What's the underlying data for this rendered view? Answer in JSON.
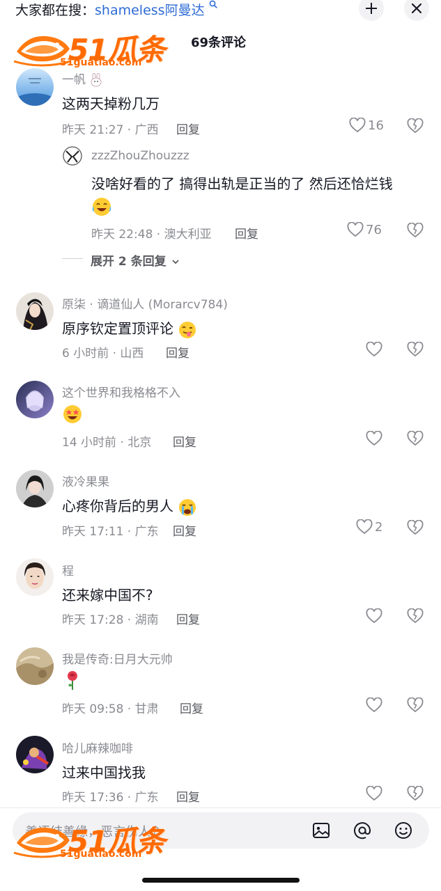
{
  "search": {
    "prefix": "大家都在搜：",
    "keyword": "shameless阿曼达",
    "search_glyph": "search-icon"
  },
  "logo": {
    "number": "51瓜条",
    "url": "51guatiao.com"
  },
  "header": {
    "comment_count": "69条评论"
  },
  "comments": [
    {
      "user": "一帆",
      "text": "这两天掉粉几万",
      "time": "昨天 21:27 · 广西",
      "reply": "回复",
      "likes": "16",
      "user_emoji": "rabbit"
    },
    {
      "user": "zzzZhouZhouzzz",
      "text": "没啥好看的了 搞得出轨是正当的了 然后还恰烂钱",
      "time": "昨天 22:48 · 澳大利亚",
      "reply": "回复",
      "likes": "76",
      "emoji": "laughing-crying-face"
    },
    {
      "user": "原柒 · 谪道仙人 (Morarcv784)",
      "text": "原序钦定置顶评论",
      "time": "6 小时前 · 山西",
      "reply": "回复",
      "likes": "",
      "emoji": "tongue-face"
    },
    {
      "user": "这个世界和我格格不入",
      "text": "",
      "time": "14 小时前 · 北京",
      "reply": "回复",
      "likes": "",
      "emoji": "star-struck-face"
    },
    {
      "user": "液冷果果",
      "text": "心疼你背后的男人",
      "time": "昨天 17:11 · 广东",
      "reply": "回复",
      "likes": "2",
      "emoji": "crying-face"
    },
    {
      "user": "程",
      "text": "还来嫁中国不?",
      "time": "昨天 17:28 · 湖南",
      "reply": "回复",
      "likes": ""
    },
    {
      "user": "我是传奇:日月大元帅",
      "text": "",
      "time": "昨天 09:58 · 甘肃",
      "reply": "回复",
      "likes": "",
      "emoji": "rose"
    },
    {
      "user": "哈儿麻辣咖啡",
      "text": "过来中国找我",
      "time": "昨天 17:36 · 广东",
      "reply": "回复",
      "likes": ""
    }
  ],
  "expand_replies": "展开 2 条回复",
  "input": {
    "placeholder": "善语结善缘，恶言伤人心"
  },
  "colors": {
    "accent": "#2e6bd6",
    "logo": "#ff6a00",
    "muted": "#8a8b91"
  }
}
